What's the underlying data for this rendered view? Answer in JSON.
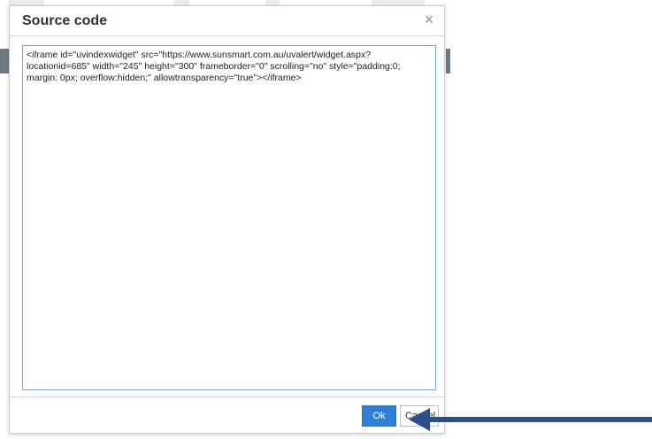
{
  "dialog": {
    "title": "Source code",
    "close_symbol": "×",
    "code": "<iframe id=\"uvindexwidget\" src=\"https://www.sunsmart.com.au/uvalert/widget.aspx?locationid=685\" width=\"245\" height=\"300\" frameborder=\"0\" scrolling=\"no\" style=\"padding:0; margin: 0px; overflow:hidden;\" allowtransparency=\"true\"></iframe>",
    "ok_label": "Ok",
    "cancel_label": "Cancel"
  },
  "annotation": {
    "arrow_color": "#2b4f88",
    "arrow_direction": "left"
  },
  "colors": {
    "accent": "#2f7ed8",
    "textarea_border": "#7aa7d6"
  }
}
